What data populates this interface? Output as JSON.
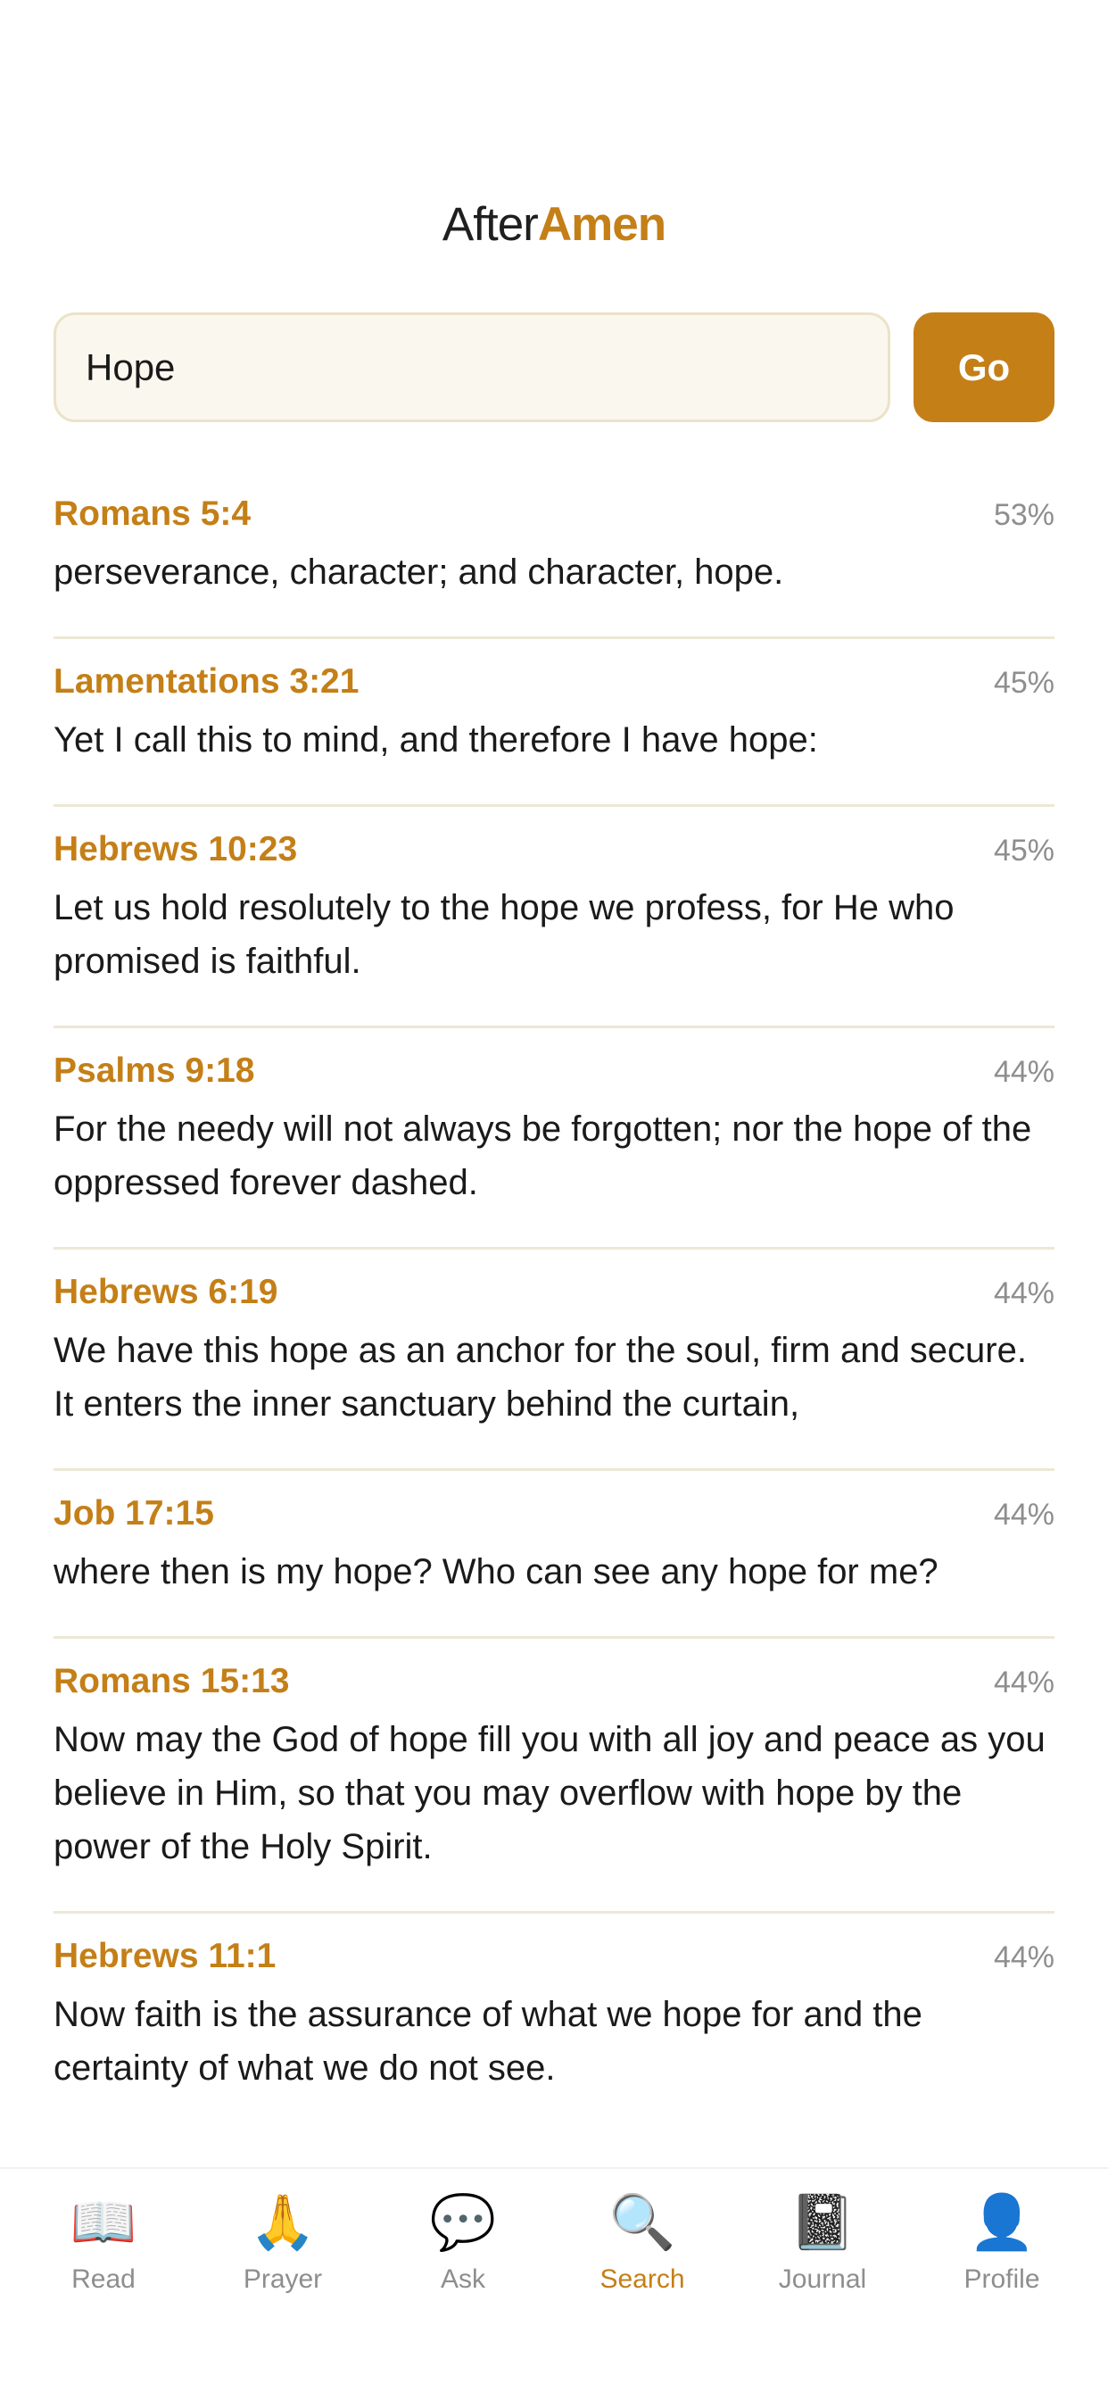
{
  "header": {
    "brand_after": "After",
    "brand_amen": "Amen"
  },
  "search": {
    "value": "Hope",
    "go_label": "Go"
  },
  "results": [
    {
      "reference": "Romans 5:4",
      "score": "53%",
      "text": "perseverance, character; and character, hope."
    },
    {
      "reference": "Lamentations 3:21",
      "score": "45%",
      "text": "Yet I call this to mind, and therefore I have hope:"
    },
    {
      "reference": "Hebrews 10:23",
      "score": "45%",
      "text": "Let us hold resolutely to the hope we profess, for He who promised is faithful."
    },
    {
      "reference": "Psalms 9:18",
      "score": "44%",
      "text": "For the needy will not always be forgotten; nor the hope of the oppressed forever dashed."
    },
    {
      "reference": "Hebrews 6:19",
      "score": "44%",
      "text": "We have this hope as an anchor for the soul, firm and secure. It enters the inner sanctuary behind the curtain,"
    },
    {
      "reference": "Job 17:15",
      "score": "44%",
      "text": "where then is my hope? Who can see any hope for me?"
    },
    {
      "reference": "Romans 15:13",
      "score": "44%",
      "text": "Now may the God of hope fill you with all joy and peace as you believe in Him, so that you may overflow with hope by the power of the Holy Spirit."
    },
    {
      "reference": "Hebrews 11:1",
      "score": "44%",
      "text": "Now faith is the assurance of what we hope for and the certainty of what we do not see."
    }
  ],
  "tabs": [
    {
      "label": "Read",
      "icon": "open-book-icon",
      "glyph": "📖",
      "active": false
    },
    {
      "label": "Prayer",
      "icon": "praying-hands-icon",
      "glyph": "🙏",
      "active": false
    },
    {
      "label": "Ask",
      "icon": "speech-bubble-icon",
      "glyph": "💬",
      "active": false
    },
    {
      "label": "Search",
      "icon": "magnifying-glass-icon",
      "glyph": "🔍",
      "active": true
    },
    {
      "label": "Journal",
      "icon": "notebook-icon",
      "glyph": "📓",
      "active": false
    },
    {
      "label": "Profile",
      "icon": "person-silhouette-icon",
      "glyph": "👤",
      "active": false
    }
  ],
  "colors": {
    "accent": "#c47f17",
    "input_background": "#faf7ef",
    "input_border": "#ebe2c8",
    "divider": "#ede7d6",
    "muted": "#8e8e8e"
  }
}
